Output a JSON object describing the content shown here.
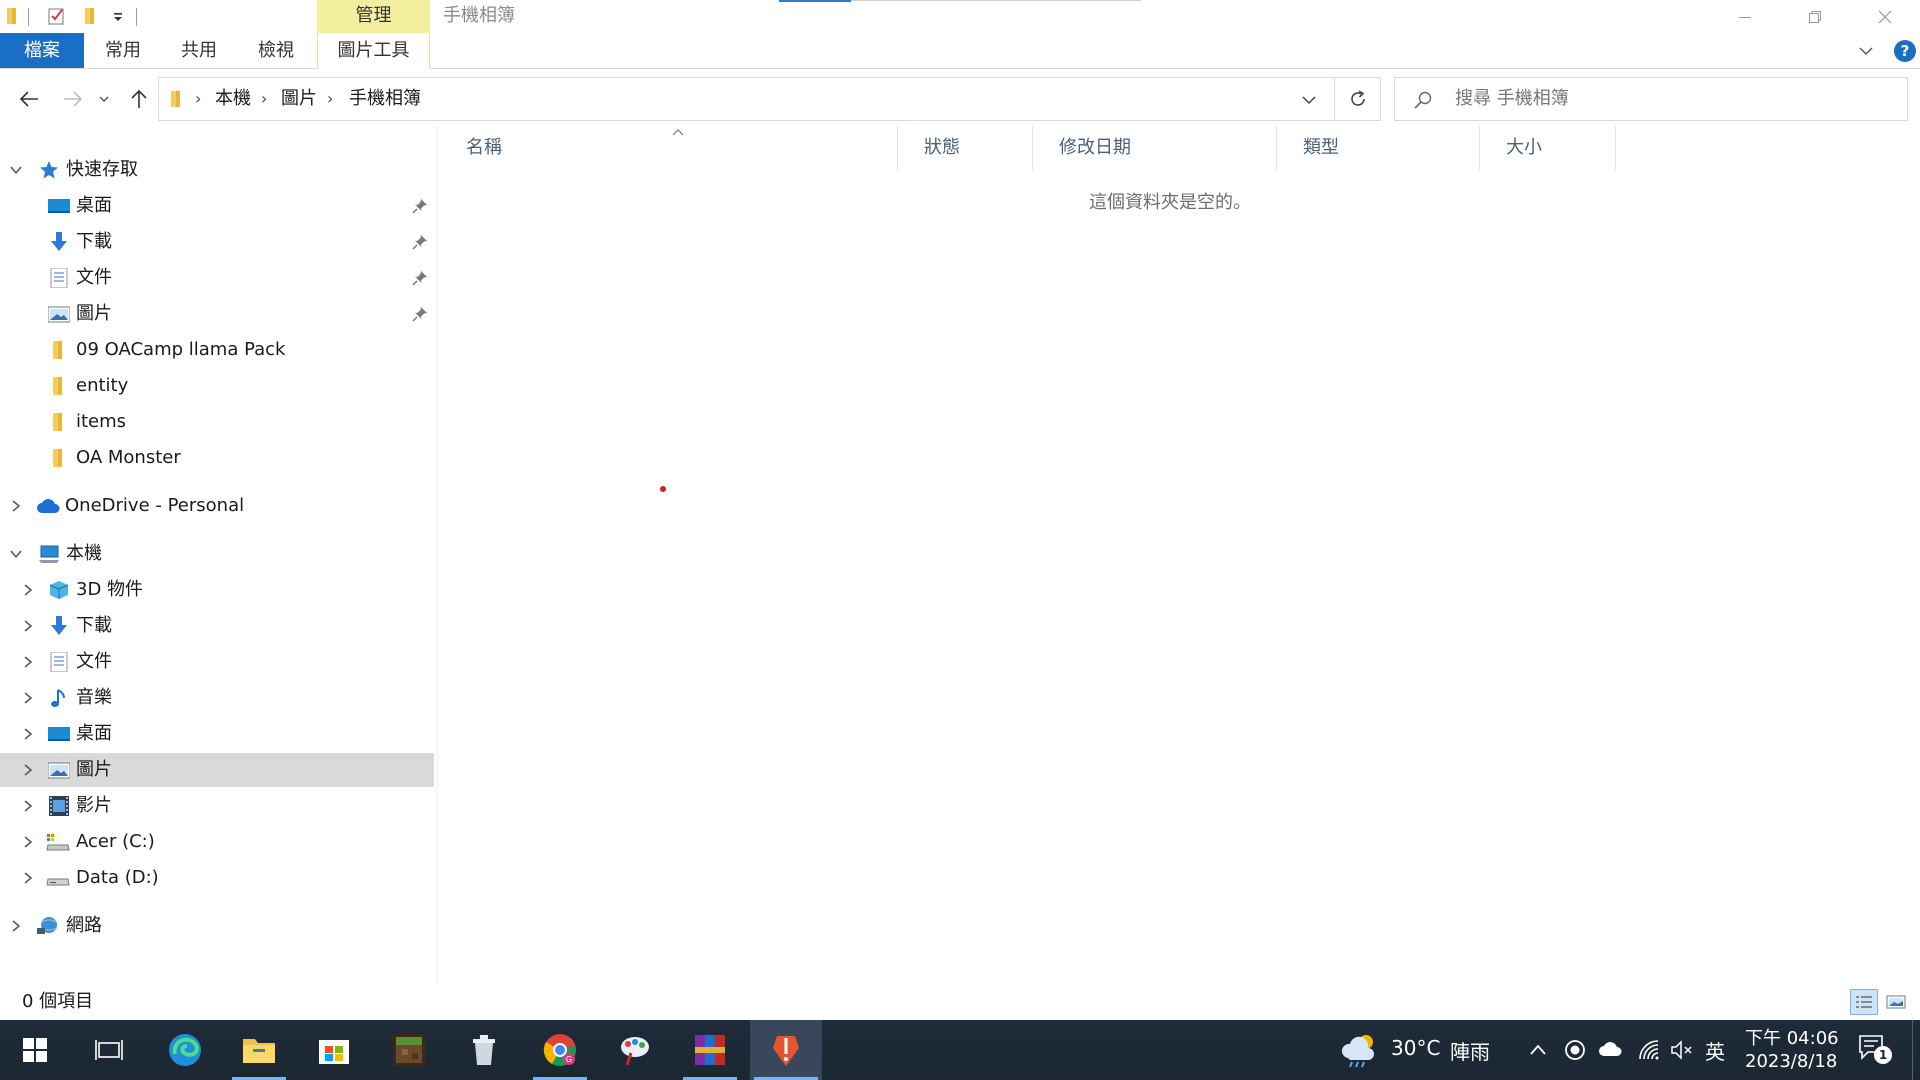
{
  "window": {
    "title": "手機相簿",
    "context_group": "管理",
    "context_tab": "圖片工具"
  },
  "ribbon": {
    "tabs": [
      "檔案",
      "常用",
      "共用",
      "檢視"
    ]
  },
  "address": {
    "crumbs": [
      "本機",
      "圖片",
      "手機相簿"
    ],
    "search_placeholder": "搜尋 手機相簿"
  },
  "nav": {
    "quick_access": "快速存取",
    "quick_items": [
      {
        "label": "桌面",
        "icon": "desktop-icon"
      },
      {
        "label": "下載",
        "icon": "download-icon"
      },
      {
        "label": "文件",
        "icon": "document-icon"
      },
      {
        "label": "圖片",
        "icon": "pictures-icon"
      },
      {
        "label": "09 OACamp llama Pack",
        "icon": "folder-icon"
      },
      {
        "label": "entity",
        "icon": "folder-icon"
      },
      {
        "label": "items",
        "icon": "folder-icon"
      },
      {
        "label": "OA Monster",
        "icon": "folder-icon"
      }
    ],
    "onedrive": "OneDrive - Personal",
    "this_pc": "本機",
    "pc_items": [
      {
        "label": "3D 物件",
        "icon": "3d-objects-icon"
      },
      {
        "label": "下載",
        "icon": "download-icon"
      },
      {
        "label": "文件",
        "icon": "document-icon"
      },
      {
        "label": "音樂",
        "icon": "music-icon"
      },
      {
        "label": "桌面",
        "icon": "desktop-icon"
      },
      {
        "label": "圖片",
        "icon": "pictures-icon"
      },
      {
        "label": "影片",
        "icon": "videos-icon"
      },
      {
        "label": "Acer (C:)",
        "icon": "drive-c-icon"
      },
      {
        "label": "Data (D:)",
        "icon": "drive-d-icon"
      }
    ],
    "network": "網路"
  },
  "columns": [
    "名稱",
    "狀態",
    "修改日期",
    "類型",
    "大小"
  ],
  "empty_message": "這個資料夾是空的。",
  "status": {
    "item_count": "0 個項目"
  },
  "taskbar": {
    "weather_temp": "30°C",
    "weather_desc": "陣雨",
    "ime": "英",
    "time": "下午 04:06",
    "date": "2023/8/18",
    "notifications": "1"
  },
  "colors": {
    "accent": "#1a6fc4",
    "context_tab": "#f4ef9e",
    "selected": "#d9d9d9",
    "taskbar": "#1f2a36"
  }
}
